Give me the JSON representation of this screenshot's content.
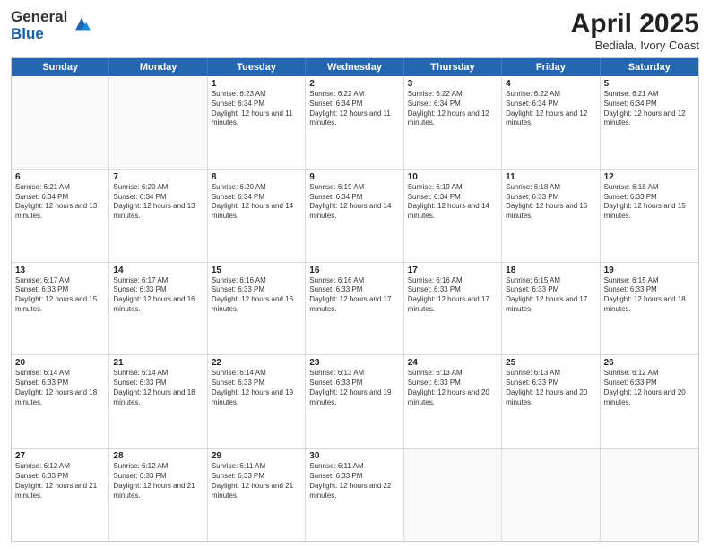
{
  "logo": {
    "general": "General",
    "blue": "Blue"
  },
  "title": {
    "month": "April 2025",
    "location": "Bediala, Ivory Coast"
  },
  "header_days": [
    "Sunday",
    "Monday",
    "Tuesday",
    "Wednesday",
    "Thursday",
    "Friday",
    "Saturday"
  ],
  "weeks": [
    [
      {
        "day": "",
        "info": ""
      },
      {
        "day": "",
        "info": ""
      },
      {
        "day": "1",
        "info": "Sunrise: 6:23 AM\nSunset: 6:34 PM\nDaylight: 12 hours and 11 minutes."
      },
      {
        "day": "2",
        "info": "Sunrise: 6:22 AM\nSunset: 6:34 PM\nDaylight: 12 hours and 11 minutes."
      },
      {
        "day": "3",
        "info": "Sunrise: 6:22 AM\nSunset: 6:34 PM\nDaylight: 12 hours and 12 minutes."
      },
      {
        "day": "4",
        "info": "Sunrise: 6:22 AM\nSunset: 6:34 PM\nDaylight: 12 hours and 12 minutes."
      },
      {
        "day": "5",
        "info": "Sunrise: 6:21 AM\nSunset: 6:34 PM\nDaylight: 12 hours and 12 minutes."
      }
    ],
    [
      {
        "day": "6",
        "info": "Sunrise: 6:21 AM\nSunset: 6:34 PM\nDaylight: 12 hours and 13 minutes."
      },
      {
        "day": "7",
        "info": "Sunrise: 6:20 AM\nSunset: 6:34 PM\nDaylight: 12 hours and 13 minutes."
      },
      {
        "day": "8",
        "info": "Sunrise: 6:20 AM\nSunset: 6:34 PM\nDaylight: 12 hours and 14 minutes."
      },
      {
        "day": "9",
        "info": "Sunrise: 6:19 AM\nSunset: 6:34 PM\nDaylight: 12 hours and 14 minutes."
      },
      {
        "day": "10",
        "info": "Sunrise: 6:19 AM\nSunset: 6:34 PM\nDaylight: 12 hours and 14 minutes."
      },
      {
        "day": "11",
        "info": "Sunrise: 6:18 AM\nSunset: 6:33 PM\nDaylight: 12 hours and 15 minutes."
      },
      {
        "day": "12",
        "info": "Sunrise: 6:18 AM\nSunset: 6:33 PM\nDaylight: 12 hours and 15 minutes."
      }
    ],
    [
      {
        "day": "13",
        "info": "Sunrise: 6:17 AM\nSunset: 6:33 PM\nDaylight: 12 hours and 15 minutes."
      },
      {
        "day": "14",
        "info": "Sunrise: 6:17 AM\nSunset: 6:33 PM\nDaylight: 12 hours and 16 minutes."
      },
      {
        "day": "15",
        "info": "Sunrise: 6:16 AM\nSunset: 6:33 PM\nDaylight: 12 hours and 16 minutes."
      },
      {
        "day": "16",
        "info": "Sunrise: 6:16 AM\nSunset: 6:33 PM\nDaylight: 12 hours and 17 minutes."
      },
      {
        "day": "17",
        "info": "Sunrise: 6:16 AM\nSunset: 6:33 PM\nDaylight: 12 hours and 17 minutes."
      },
      {
        "day": "18",
        "info": "Sunrise: 6:15 AM\nSunset: 6:33 PM\nDaylight: 12 hours and 17 minutes."
      },
      {
        "day": "19",
        "info": "Sunrise: 6:15 AM\nSunset: 6:33 PM\nDaylight: 12 hours and 18 minutes."
      }
    ],
    [
      {
        "day": "20",
        "info": "Sunrise: 6:14 AM\nSunset: 6:33 PM\nDaylight: 12 hours and 18 minutes."
      },
      {
        "day": "21",
        "info": "Sunrise: 6:14 AM\nSunset: 6:33 PM\nDaylight: 12 hours and 18 minutes."
      },
      {
        "day": "22",
        "info": "Sunrise: 6:14 AM\nSunset: 6:33 PM\nDaylight: 12 hours and 19 minutes."
      },
      {
        "day": "23",
        "info": "Sunrise: 6:13 AM\nSunset: 6:33 PM\nDaylight: 12 hours and 19 minutes."
      },
      {
        "day": "24",
        "info": "Sunrise: 6:13 AM\nSunset: 6:33 PM\nDaylight: 12 hours and 20 minutes."
      },
      {
        "day": "25",
        "info": "Sunrise: 6:13 AM\nSunset: 6:33 PM\nDaylight: 12 hours and 20 minutes."
      },
      {
        "day": "26",
        "info": "Sunrise: 6:12 AM\nSunset: 6:33 PM\nDaylight: 12 hours and 20 minutes."
      }
    ],
    [
      {
        "day": "27",
        "info": "Sunrise: 6:12 AM\nSunset: 6:33 PM\nDaylight: 12 hours and 21 minutes."
      },
      {
        "day": "28",
        "info": "Sunrise: 6:12 AM\nSunset: 6:33 PM\nDaylight: 12 hours and 21 minutes."
      },
      {
        "day": "29",
        "info": "Sunrise: 6:11 AM\nSunset: 6:33 PM\nDaylight: 12 hours and 21 minutes."
      },
      {
        "day": "30",
        "info": "Sunrise: 6:11 AM\nSunset: 6:33 PM\nDaylight: 12 hours and 22 minutes."
      },
      {
        "day": "",
        "info": ""
      },
      {
        "day": "",
        "info": ""
      },
      {
        "day": "",
        "info": ""
      }
    ]
  ]
}
